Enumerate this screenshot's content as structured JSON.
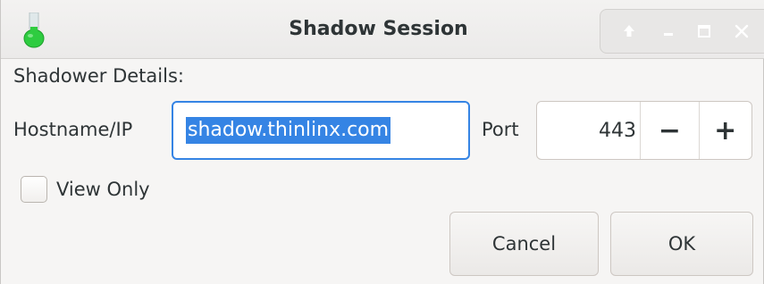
{
  "window": {
    "title": "Shadow Session",
    "icon": "flask-icon",
    "controls": [
      "keep-above-icon",
      "minimize-icon",
      "maximize-icon",
      "close-icon"
    ]
  },
  "form": {
    "section_label": "Shadower Details:",
    "hostname_label": "Hostname/IP",
    "hostname_value": "shadow.thinlinx.com",
    "port_label": "Port",
    "port_value": "443",
    "port_decrement": "−",
    "port_increment": "+",
    "view_only_label": "View Only",
    "view_only_checked": false
  },
  "buttons": {
    "cancel": "Cancel",
    "ok": "OK"
  },
  "colors": {
    "accent": "#3584e4",
    "flask_liquid": "#2ecc40"
  }
}
